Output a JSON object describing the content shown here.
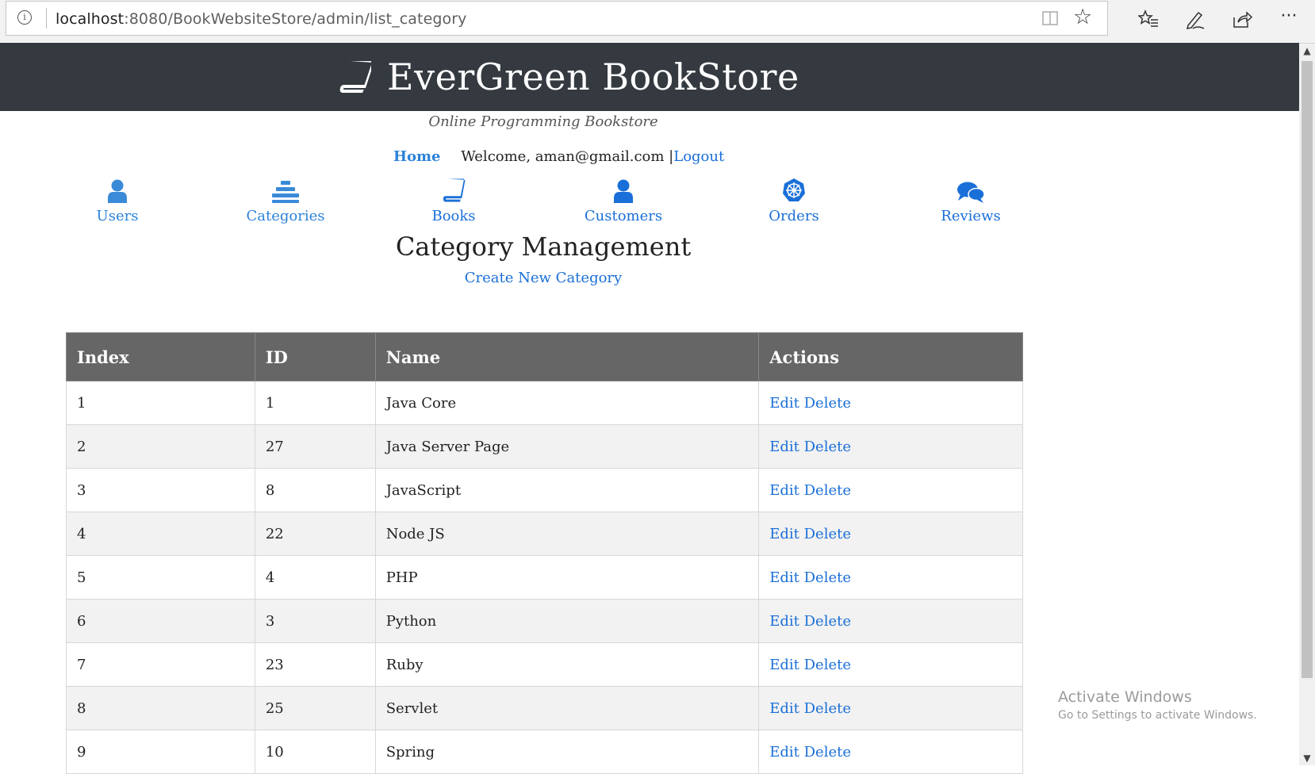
{
  "browser": {
    "url_host": "localhost",
    "url_rest": ":8080/BookWebsiteStore/admin/list_category",
    "info_icon": "info-icon",
    "reader_icon": "reading-view-icon",
    "favorite_icon": "star-icon",
    "toolbar": [
      "favorites-hub-icon",
      "pen-icon",
      "share-icon",
      "more-icon"
    ],
    "more_label": "···"
  },
  "header": {
    "brand": "EverGreen BookStore",
    "brand_icon": "book-icon",
    "tagline": "Online Programming Bookstore",
    "bg_color": "#343a40"
  },
  "topnav": {
    "home": "Home",
    "welcome": "Welcome, aman@gmail.com |",
    "logout": "Logout"
  },
  "menu": [
    {
      "label": "Users",
      "icon": "user-icon"
    },
    {
      "label": "Categories",
      "icon": "categories-icon"
    },
    {
      "label": "Books",
      "icon": "book-icon"
    },
    {
      "label": "Customers",
      "icon": "customer-icon"
    },
    {
      "label": "Orders",
      "icon": "orders-icon"
    },
    {
      "label": "Reviews",
      "icon": "comments-icon"
    }
  ],
  "main": {
    "title": "Category Management",
    "create_link": "Create New Category"
  },
  "table": {
    "headers": [
      "Index",
      "ID",
      "Name",
      "Actions"
    ],
    "edit_label": "Edit",
    "delete_label": "Delete",
    "rows": [
      {
        "index": "1",
        "id": "1",
        "name": "Java Core"
      },
      {
        "index": "2",
        "id": "27",
        "name": "Java Server Page"
      },
      {
        "index": "3",
        "id": "8",
        "name": "JavaScript"
      },
      {
        "index": "4",
        "id": "22",
        "name": "Node JS"
      },
      {
        "index": "5",
        "id": "4",
        "name": "PHP"
      },
      {
        "index": "6",
        "id": "3",
        "name": "Python"
      },
      {
        "index": "7",
        "id": "23",
        "name": "Ruby"
      },
      {
        "index": "8",
        "id": "25",
        "name": "Servlet"
      },
      {
        "index": "9",
        "id": "10",
        "name": "Spring"
      }
    ]
  },
  "watermark": {
    "line1": "Activate Windows",
    "line2": "Go to Settings to activate Windows."
  },
  "colors": {
    "link": "#1a6fd8",
    "menu_link": "#2b82d8",
    "table_header": "#666666",
    "row_alt": "#f2f2f2"
  }
}
